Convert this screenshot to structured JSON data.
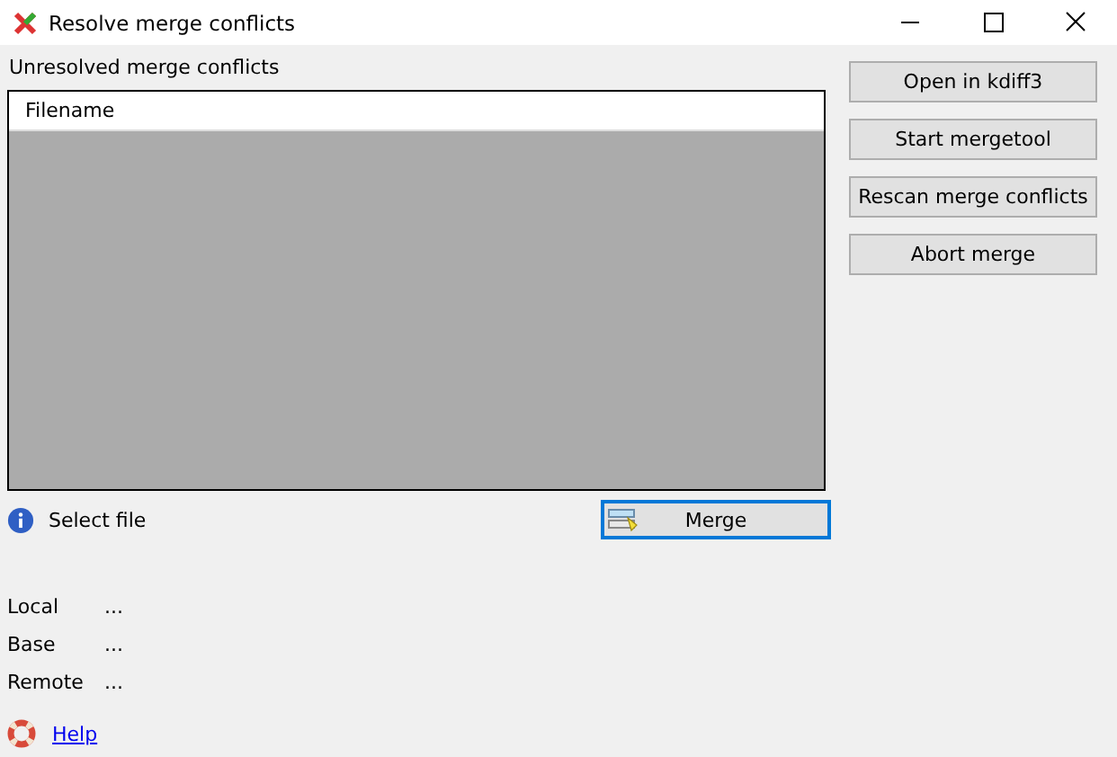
{
  "window": {
    "title": "Resolve merge conflicts"
  },
  "list_label": "Unresolved merge conflicts",
  "table": {
    "columns": [
      "Filename"
    ]
  },
  "status": "Select file",
  "merge_button": {
    "label": "Merge",
    "focused": true
  },
  "buttons": [
    "Open in kdiff3",
    "Start mergetool",
    "Rescan merge conflicts",
    "Abort merge"
  ],
  "details": [
    {
      "label": "Local",
      "value": "..."
    },
    {
      "label": "Base",
      "value": "..."
    },
    {
      "label": "Remote",
      "value": "..."
    }
  ],
  "help_link": "Help"
}
